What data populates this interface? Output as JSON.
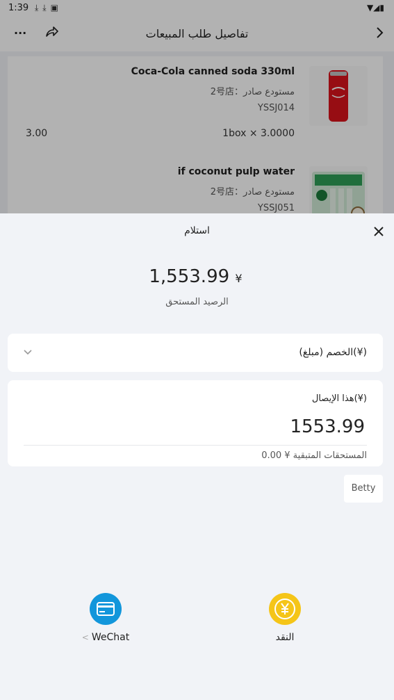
{
  "status_bar": {
    "time": "1:39"
  },
  "header": {
    "title": "تفاصيل طلب المبيعات",
    "more_label": "···"
  },
  "products": [
    {
      "name": "Coca-Cola canned soda 330ml",
      "store": "2号店：مستودع صادر",
      "code": "YSSJ014",
      "qty": "1box ×  3.0000",
      "amount": "3.00",
      "thumb_icon": "cola-can-image"
    },
    {
      "name": "if coconut pulp water",
      "store": "2号店：مستودع صادر",
      "code": "YSSJ051",
      "qty": "",
      "amount": "",
      "thumb_icon": "coconut-water-pack-image"
    }
  ],
  "sheet": {
    "title": "استلام",
    "balance_currency": "¥",
    "balance_amount": "1,553.99",
    "balance_label": "الرصيد المستحق",
    "discount_label": "الخصم (مبلغ)(¥)",
    "receipt_label": "هذا الإيصال(¥)",
    "receipt_amount": "1553.99",
    "remaining": "المستحقات المتبقية ¥ 0.00",
    "operator": "Betty"
  },
  "payment_methods": [
    {
      "label": "WeChat",
      "icon": "card-icon",
      "color": "#1296db"
    },
    {
      "label": "النقد",
      "icon": "yuan-coin-icon",
      "color": "#f5c518"
    }
  ],
  "colors": {
    "accent_blue": "#1296db",
    "accent_gold": "#f5c518",
    "background": "#f1f3f7"
  }
}
